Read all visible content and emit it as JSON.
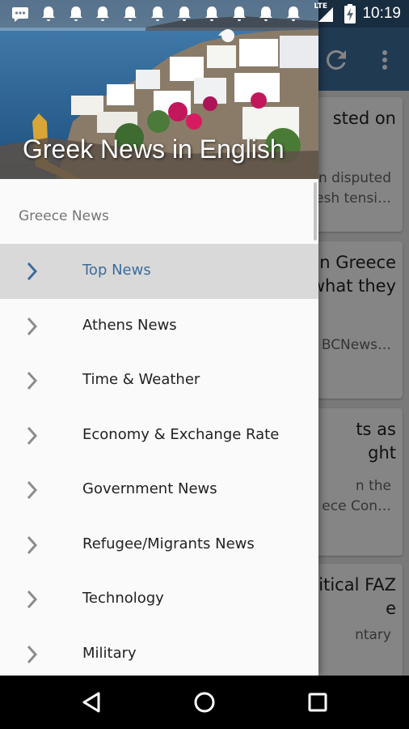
{
  "status_bar": {
    "notification_icons": [
      "message-icon",
      "bell-icon",
      "bell-icon",
      "bell-icon",
      "bell-icon",
      "bell-icon",
      "bell-icon",
      "bell-icon",
      "bell-icon",
      "bell-icon",
      "bell-icon"
    ],
    "network_label": "LTE",
    "time": "10:19"
  },
  "background_app": {
    "toolbar_color": "#3f6f9e",
    "toolbar_icons": [
      "refresh-icon",
      "overflow-menu-icon"
    ],
    "cards": [
      {
        "title": "sted on",
        "snippet": "n disputed\nesh tensi…"
      },
      {
        "title": "n Greece\nwhat they",
        "snippet": "BCNews…"
      },
      {
        "title": "ts as\nght",
        "snippet": "n the\nece  Con…"
      },
      {
        "title": "itical FAZ\ne",
        "snippet": "ntary"
      }
    ]
  },
  "drawer": {
    "header_title": "Greek News in English",
    "section_label": "Greece News",
    "accent_color": "#3d6c9b",
    "items": [
      {
        "label": "Top News",
        "active": true
      },
      {
        "label": "Athens News",
        "active": false
      },
      {
        "label": "Time & Weather",
        "active": false
      },
      {
        "label": "Economy & Exchange Rate",
        "active": false
      },
      {
        "label": "Government News",
        "active": false
      },
      {
        "label": "Refugee/Migrants News",
        "active": false
      },
      {
        "label": "Technology",
        "active": false
      },
      {
        "label": "Military",
        "active": false
      }
    ]
  },
  "nav_bar": {
    "buttons": [
      "back-icon",
      "home-icon",
      "recents-icon"
    ]
  }
}
